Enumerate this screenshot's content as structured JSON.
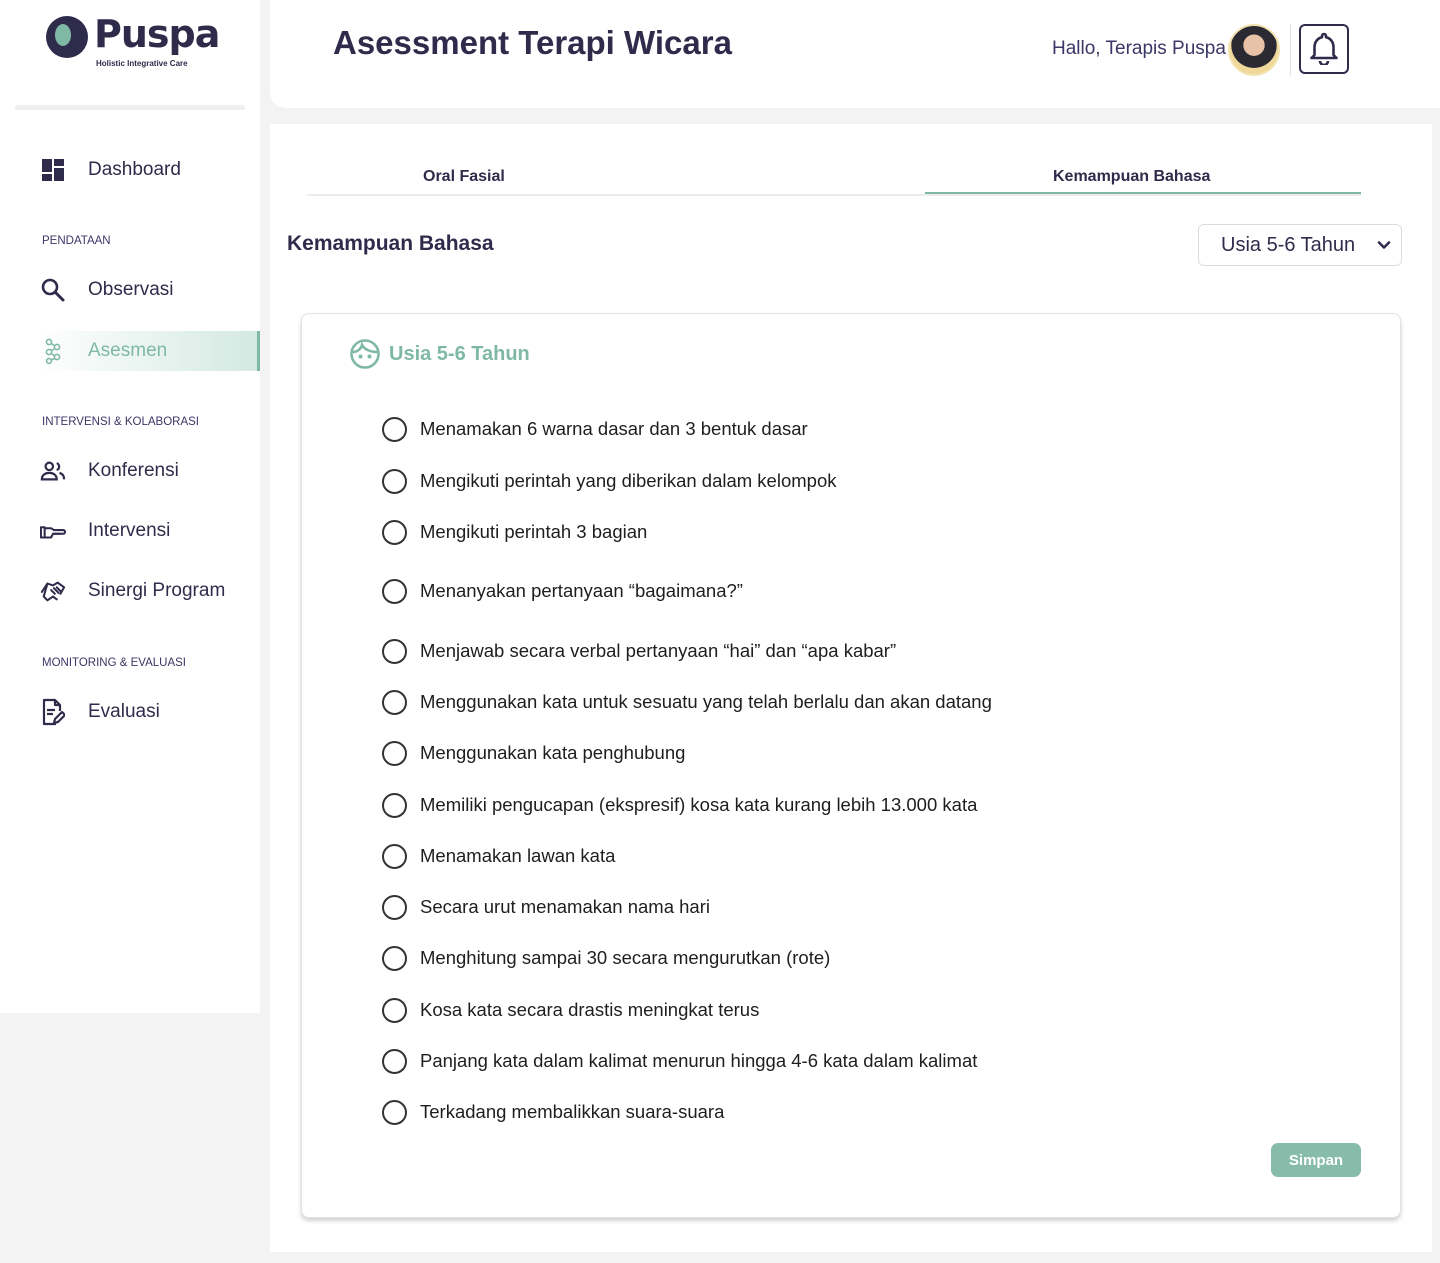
{
  "brand": {
    "name": "Puspa",
    "tagline": "Holistic Integrative Care"
  },
  "sidebar": {
    "dashboard": {
      "label": "Dashboard",
      "icon": "dashboard-icon"
    },
    "sections": [
      {
        "title": "PENDATAAN",
        "items": [
          {
            "label": "Observasi",
            "icon": "search-icon"
          },
          {
            "label": "Asesmen",
            "icon": "molecule-icon",
            "active": true
          }
        ]
      },
      {
        "title": "INTERVENSI & KOLABORASI",
        "items": [
          {
            "label": "Konferensi",
            "icon": "people-icon"
          },
          {
            "label": "Intervensi",
            "icon": "hand-icon"
          },
          {
            "label": "Sinergi Program",
            "icon": "handshake-icon"
          }
        ]
      },
      {
        "title": "MONITORING & EVALUASI",
        "items": [
          {
            "label": "Evaluasi",
            "icon": "document-edit-icon"
          }
        ]
      }
    ]
  },
  "header": {
    "title": "Asessment Terapi Wicara",
    "greeting": "Hallo, Terapis Puspa",
    "notification_icon": "bell-icon"
  },
  "tabs": [
    {
      "label": "Oral Fasial",
      "active": false
    },
    {
      "label": "Kemampuan Bahasa",
      "active": true
    }
  ],
  "section": {
    "heading": "Kemampuan Bahasa",
    "age_select": {
      "value": "Usia 5-6 Tahun"
    }
  },
  "card": {
    "title": "Usia 5-6 Tahun",
    "icon": "child-face-icon",
    "options": [
      "Menamakan 6 warna dasar dan 3 bentuk dasar",
      "Mengikuti perintah yang diberikan dalam kelompok",
      "Mengikuti perintah 3 bagian",
      "Menanyakan pertanyaan “bagaimana?”",
      "Menjawab secara verbal pertanyaan “hai” dan “apa kabar”",
      "Menggunakan kata untuk sesuatu yang telah berlalu dan akan datang",
      "Menggunakan kata penghubung",
      "Memiliki pengucapan (ekspresif) kosa kata kurang lebih 13.000 kata",
      "Menamakan lawan kata",
      "Secara urut menamakan nama hari",
      "Menghitung sampai 30 secara mengurutkan (rote)",
      "Kosa kata secara drastis meningkat terus",
      "Panjang kata dalam kalimat menurun hingga 4-6 kata dalam kalimat",
      "Terkadang membalikkan suara-suara"
    ],
    "save_label": "Simpan"
  },
  "colors": {
    "primary": "#2f2b4b",
    "accent": "#7fb9a6",
    "button": "#87bcaa"
  }
}
